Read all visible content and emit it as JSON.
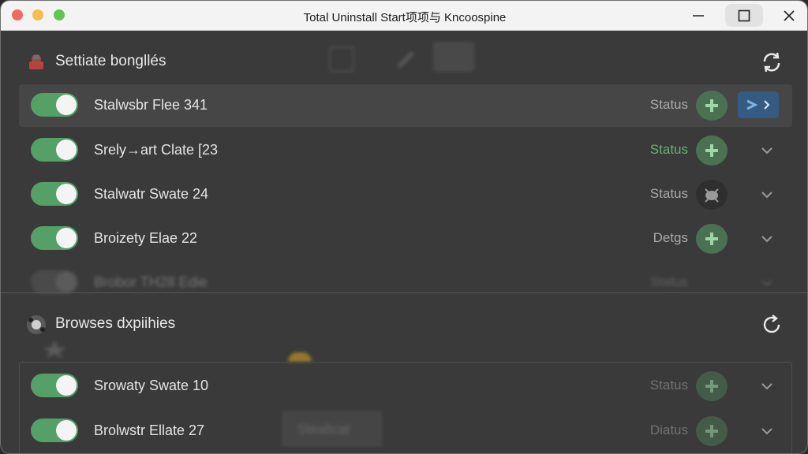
{
  "window": {
    "title": "Total Uninstall Start项项与 Kncoospine"
  },
  "sections": [
    {
      "title": "Settiate bongllés",
      "rows": [
        {
          "label": "Stalwsbr Fleе 341",
          "status": "Status",
          "status_color": "#a9a9a9"
        },
        {
          "label": "Srely→art Clate [23",
          "status": "Status",
          "status_color": "#64b56f"
        },
        {
          "label": "Stalwatr Swate 24",
          "status": "Status",
          "status_color": "#a9a9a9"
        },
        {
          "label": "Broizety Elae 22",
          "status": "Detgs",
          "status_color": "#a9a9a9"
        },
        {
          "label": "Brobor TH28 Edie",
          "status": "Status",
          "status_color": "#a9a9a9"
        }
      ]
    },
    {
      "title": "Browses dxpiihies",
      "rows": [
        {
          "label": "Srowaty Swate 10",
          "status": "Status",
          "status_color": "#a9a9a9"
        },
        {
          "label": "Brolwstr Ellate 27",
          "status": "Diatus",
          "status_color": "#a9a9a9"
        }
      ]
    }
  ],
  "background": {
    "ghost_button": "Stealtcat"
  },
  "colors": {
    "toggle_on": "#54a067",
    "status_badge": "#4a7252",
    "action_button": "#355b82",
    "titlebar": "#f3f3f3"
  },
  "icons": {
    "refresh": "refresh-icon",
    "chevron": "chevron-down-icon",
    "badge": "plus-badge-icon"
  }
}
